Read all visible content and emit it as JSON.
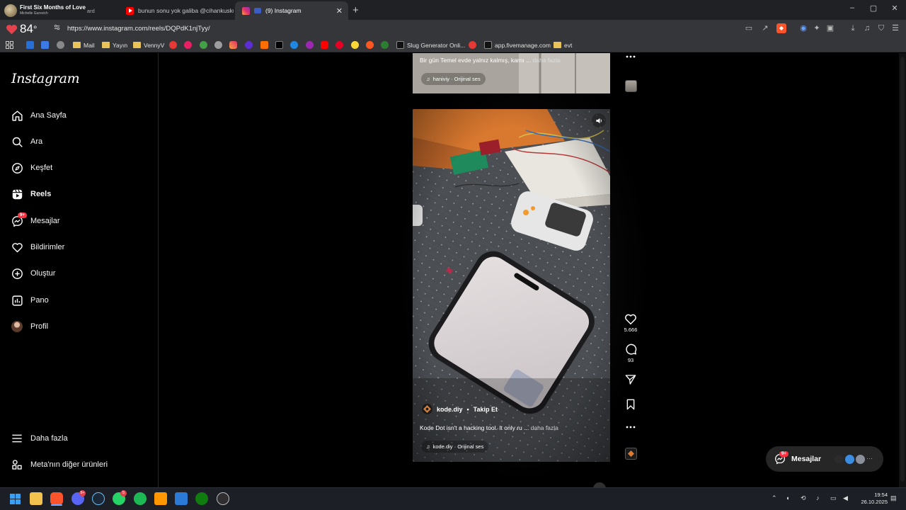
{
  "browser": {
    "tabs": [
      {
        "title": "First Six Months of Love",
        "subtitle": "Michelle Gurevich",
        "suffix": "ard",
        "favicon_color": "#7a6a4a"
      },
      {
        "title": "bunun sonu yok galiba @cihankusku",
        "favicon_color": "#ff0000"
      },
      {
        "title": "(9) Instagram",
        "favicon_color": "#e1306c",
        "active": true
      }
    ],
    "new_tab_label": "+",
    "window_controls": {
      "minimize": "–",
      "maximize": "▢",
      "close": "✕"
    },
    "weather_temp": "84",
    "weather_unit": "°",
    "url": "https://www.instagram.com/reels/DQPdK1njTyy/",
    "bookmarks": [
      {
        "label": "",
        "icon": "zte-icon",
        "color": "#2a6fd6"
      },
      {
        "label": "",
        "icon": "play-icon",
        "color": "#3c7ae8"
      },
      {
        "label": "",
        "icon": "at-icon",
        "color": "#888888"
      },
      {
        "label": "Mail",
        "icon": "folder-icon"
      },
      {
        "label": "Yayın",
        "icon": "folder-icon"
      },
      {
        "label": "VennyV",
        "icon": "folder-icon"
      },
      {
        "label": "Slug Generator Onli...",
        "icon": "slug-icon"
      },
      {
        "label": "app.fivemanage.com",
        "icon": "fivemanage-icon"
      },
      {
        "label": "evt",
        "icon": "folder-icon"
      }
    ]
  },
  "instagram": {
    "logo": "Instagram",
    "nav": [
      {
        "label": "Ana Sayfa",
        "icon": "home-icon"
      },
      {
        "label": "Ara",
        "icon": "search-icon"
      },
      {
        "label": "Keşfet",
        "icon": "compass-icon"
      },
      {
        "label": "Reels",
        "icon": "reels-icon",
        "active": true
      },
      {
        "label": "Mesajlar",
        "icon": "messenger-icon",
        "badge": "9+"
      },
      {
        "label": "Bildirimler",
        "icon": "heart-icon"
      },
      {
        "label": "Oluştur",
        "icon": "plus-square-icon"
      },
      {
        "label": "Pano",
        "icon": "dashboard-icon"
      },
      {
        "label": "Profil",
        "icon": "avatar"
      }
    ],
    "more": "Daha fazla",
    "meta": "Meta'nın diğer ürünleri",
    "prev_reel": {
      "caption": "Bir gün Temel evde yalnız kalmış, karnı ...",
      "more": "daha fazla",
      "audio": "haniviy · Orijinal ses"
    },
    "reel": {
      "username": "kode.diy",
      "separator": "•",
      "follow": "Takip Et",
      "caption": "Kode Dot isn't a hacking tool. It only ru ...",
      "more": "daha fazla",
      "audio": "kode.diy · Orijinal ses",
      "likes": "5.666",
      "comments": "93"
    },
    "messages_pill": {
      "label": "Mesajlar",
      "badge": "9+",
      "more": "···"
    }
  },
  "taskbar": {
    "apps": [
      {
        "name": "windows-start",
        "color": "#3aa0f3"
      },
      {
        "name": "file-explorer",
        "color": "#f2c14e"
      },
      {
        "name": "brave",
        "color": "#fb542b"
      },
      {
        "name": "discord",
        "color": "#5865f2",
        "badge": "9+"
      },
      {
        "name": "steam",
        "color": "#1b2838"
      },
      {
        "name": "whatsapp",
        "color": "#25d366",
        "badge": "5"
      },
      {
        "name": "spotify",
        "color": "#1db954"
      },
      {
        "name": "sublime",
        "color": "#ff9800"
      },
      {
        "name": "app-blue",
        "color": "#2a7ad6"
      },
      {
        "name": "xbox",
        "color": "#107c10"
      },
      {
        "name": "obs",
        "color": "#302e31"
      }
    ],
    "time": "19:54",
    "date": "26.10.2025"
  }
}
